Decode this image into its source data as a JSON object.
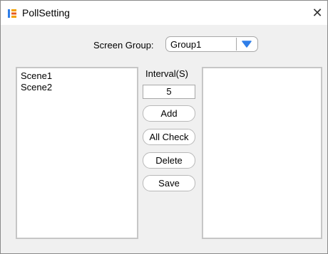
{
  "window": {
    "title": "PollSetting",
    "close_glyph": "✕",
    "app_icon": "app-logo-icon",
    "accent_color": "#2f7ee8"
  },
  "screen_group": {
    "label": "Screen Group:",
    "selected_value": "Group1",
    "dropdown_icon": "chevron-down-icon"
  },
  "scene_list": {
    "items": [
      "Scene1",
      "Scene2"
    ]
  },
  "interval": {
    "label": "Interval(S)",
    "value": "5"
  },
  "buttons": {
    "add": "Add",
    "all_check": "All Check",
    "delete": "Delete",
    "save": "Save"
  },
  "selected_list": {
    "items": []
  }
}
